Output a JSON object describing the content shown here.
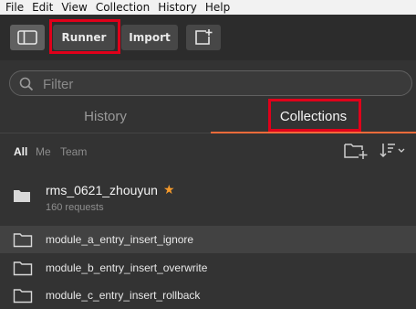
{
  "menu": [
    "File",
    "Edit",
    "View",
    "Collection",
    "History",
    "Help"
  ],
  "toolbar": {
    "runner_label": "Runner",
    "import_label": "Import"
  },
  "search": {
    "placeholder": "Filter",
    "value": ""
  },
  "tabs": [
    {
      "label": "History",
      "active": false
    },
    {
      "label": "Collections",
      "active": true
    }
  ],
  "filters": {
    "all": "All",
    "me": "Me",
    "team": "Team"
  },
  "collection": {
    "name": "rms_0621_zhouyun",
    "starred": true,
    "request_count": "160 requests"
  },
  "folders": [
    {
      "name": "module_a_entry_insert_ignore",
      "selected": true
    },
    {
      "name": "module_b_entry_insert_overwrite",
      "selected": false
    },
    {
      "name": "module_c_entry_insert_rollback",
      "selected": false
    }
  ],
  "colors": {
    "accent": "#f26b3a",
    "highlight_box": "#e0001a",
    "star": "#f59a2b",
    "background": "#333333"
  }
}
